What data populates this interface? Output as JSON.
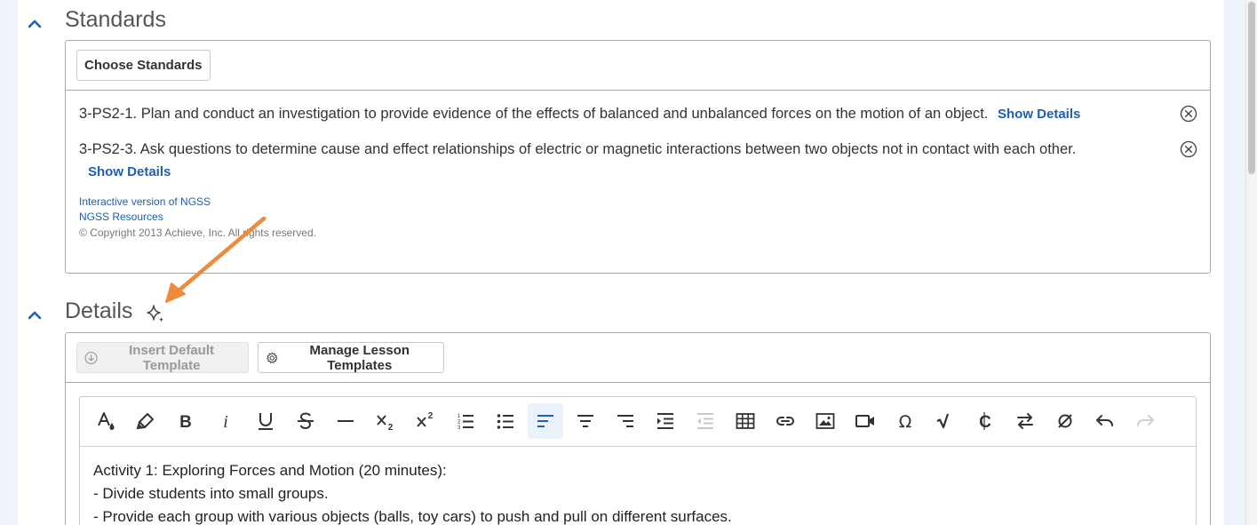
{
  "standards": {
    "title": "Standards",
    "choose_label": "Choose Standards",
    "items": [
      {
        "text": "3-PS2-1. Plan and conduct an investigation to provide evidence of the effects of balanced and unbalanced forces on the motion of an object.",
        "details_label": "Show Details"
      },
      {
        "text": "3-PS2-3. Ask questions to determine cause and effect relationships of electric or magnetic interactions between two objects not in contact with each other.",
        "details_label": "Show Details"
      }
    ],
    "links": [
      "Interactive version of NGSS",
      "NGSS Resources"
    ],
    "copyright": "© Copyright 2013 Achieve, Inc. All rights reserved."
  },
  "details": {
    "title": "Details",
    "insert_template_label": "Insert Default Template",
    "manage_templates_label": "Manage Lesson Templates",
    "toolbar": [
      "text-color",
      "highlight",
      "bold",
      "italic",
      "underline",
      "strikethrough",
      "horizontal-line",
      "subscript",
      "superscript",
      "numbered-list",
      "bulleted-list",
      "align-left",
      "align-center",
      "align-right",
      "indent",
      "outdent",
      "table",
      "link",
      "image",
      "video",
      "special-character",
      "equation",
      "copy-formatting",
      "swap",
      "clear-formatting",
      "undo",
      "redo"
    ],
    "content": [
      "Activity 1: Exploring Forces and Motion (20 minutes):",
      "- Divide students into small groups.",
      "- Provide each group with various objects (balls, toy cars) to push and pull on different surfaces."
    ]
  },
  "colors": {
    "accent": "#1f5fae",
    "annotation_arrow": "#ef8a3c",
    "side_band": "#eef3f9"
  }
}
